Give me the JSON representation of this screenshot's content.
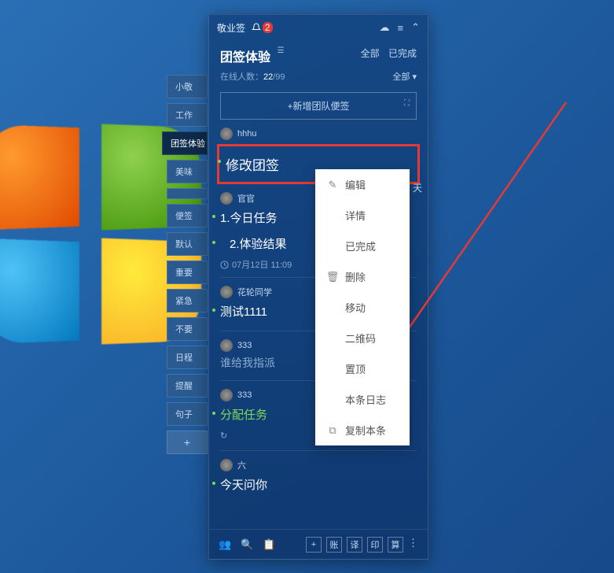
{
  "app": {
    "name": "敬业签",
    "badge": "2"
  },
  "header": {
    "team": "团签体验",
    "tag": "☰",
    "filter_all": "全部",
    "filter_done": "已完成",
    "online_label": "在线人数：",
    "online_cur": "22",
    "online_total": "/99",
    "online_filter": "全部 ▾",
    "new_btn": "+新增团队便签"
  },
  "side_tabs": [
    "小敬",
    "工作",
    "团签体验",
    "美味",
    "",
    "便签",
    "默认",
    "重要",
    "紧急",
    "不要",
    "日程",
    "提醒",
    "句子"
  ],
  "side_plus": "+",
  "notes": [
    {
      "user": "hhhu",
      "title": "修改团签",
      "highlight": true
    },
    {
      "user": "官官",
      "title": "1.今日任务",
      "title2": "2.体验结果",
      "time": "07月12日 11:09"
    },
    {
      "user": "花轮同学",
      "title": "测试1111"
    },
    {
      "user": "333",
      "muted": "谁给我指派"
    },
    {
      "user": "333",
      "muted2": "分配任务"
    },
    {
      "user": "六",
      "title": "今天问你"
    }
  ],
  "context_menu": [
    {
      "icon": "✎",
      "label": "编辑"
    },
    {
      "icon": "",
      "label": "详情"
    },
    {
      "icon": "",
      "label": "已完成"
    },
    {
      "icon": "🗑",
      "label": "删除"
    },
    {
      "icon": "",
      "label": "移动"
    },
    {
      "icon": "",
      "label": "二维码"
    },
    {
      "icon": "",
      "label": "置顶"
    },
    {
      "icon": "",
      "label": "本条日志"
    },
    {
      "icon": "⧉",
      "label": "复制本条"
    }
  ],
  "date_hint": "天",
  "bottom": {
    "sq1": "+",
    "sq2": "账",
    "sq3": "译",
    "sq4": "印",
    "sq5": "算"
  }
}
